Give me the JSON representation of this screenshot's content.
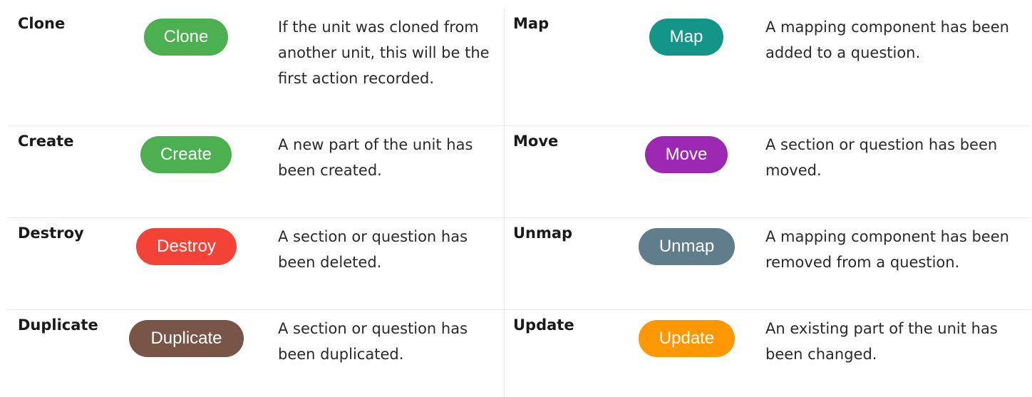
{
  "rows": [
    {
      "left": {
        "term": "Clone",
        "badge": "Clone",
        "color": "#4caf50",
        "description": "If the unit was cloned from another unit, this will be the first action recorded."
      },
      "right": {
        "term": "Map",
        "badge": "Map",
        "color": "#139688",
        "description": "A mapping component has been added to a question."
      }
    },
    {
      "left": {
        "term": "Create",
        "badge": "Create",
        "color": "#4caf50",
        "description": "A new part of the unit has been created."
      },
      "right": {
        "term": "Move",
        "badge": "Move",
        "color": "#9c27b0",
        "description": "A section or question has been moved."
      }
    },
    {
      "left": {
        "term": "Destroy",
        "badge": "Destroy",
        "color": "#f44336",
        "description": "A section or question has been deleted."
      },
      "right": {
        "term": "Unmap",
        "badge": "Unmap",
        "color": "#607d8b",
        "description": "A mapping component has been removed from a question."
      }
    },
    {
      "left": {
        "term": "Duplicate",
        "badge": "Duplicate",
        "color": "#795548",
        "description": "A section or question has been duplicated."
      },
      "right": {
        "term": "Update",
        "badge": "Update",
        "color": "#ff9800",
        "description": "An existing part of the unit has been changed."
      }
    }
  ]
}
